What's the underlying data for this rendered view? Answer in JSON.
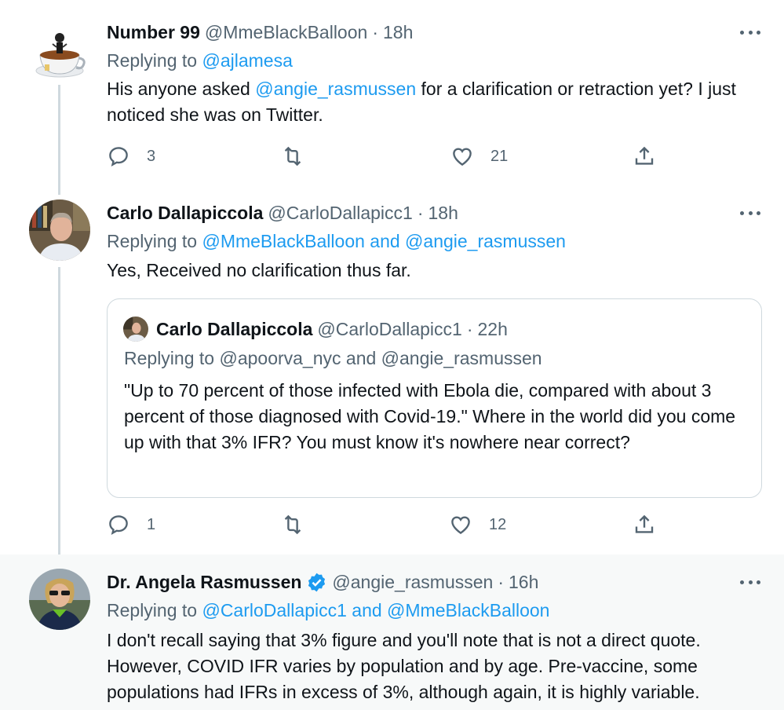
{
  "tweets": [
    {
      "name": "Number 99",
      "handle": "@MmeBlackBalloon",
      "dot": "·",
      "time": "18h",
      "reply_prefix": "Replying to",
      "reply_to": "@ajlamesa",
      "text_before": "His anyone asked ",
      "mention": "@angie_rasmussen",
      "text_after": " for a clarification or retraction yet? I just noticed she was on Twitter.",
      "replies": "3",
      "retweets": "",
      "likes": "21",
      "avatar_icon": "teacup-avatar"
    },
    {
      "name": "Carlo Dallapiccola",
      "handle": "@CarloDallapicc1",
      "dot": "·",
      "time": "18h",
      "reply_prefix": "Replying to",
      "reply_to": "@MmeBlackBalloon and @angie_rasmussen",
      "text": "Yes,  Received no clarification thus far.",
      "replies": "1",
      "retweets": "",
      "likes": "12",
      "avatar_icon": "person-avatar",
      "quote": {
        "name": "Carlo Dallapiccola",
        "handle": "@CarloDallapicc1",
        "dot": "·",
        "time": "22h",
        "reply_prefix": "Replying to",
        "reply_to": "@apoorva_nyc and @angie_rasmussen",
        "text": "\"Up to 70 percent of those infected with Ebola die, compared with about 3 percent of those diagnosed with Covid-19.\"  Where in the world did you come up with that 3% IFR? You must know it's nowhere near correct?"
      }
    },
    {
      "name": "Dr. Angela Rasmussen",
      "handle": "@angie_rasmussen",
      "dot": "·",
      "time": "16h",
      "reply_prefix": "Replying to",
      "reply_to": "@CarloDallapicc1 and @MmeBlackBalloon",
      "text": "I don't recall saying that 3% figure and you'll note that is not a direct quote. However, COVID IFR varies by population and by age. Pre-vaccine, some populations had IFRs in excess of 3%, although again, it is highly variable.",
      "avatar_icon": "person-sunglasses-avatar",
      "verified": true
    }
  ],
  "colors": {
    "link": "#1d9bf0",
    "secondary_text": "#536471",
    "highlight_bg": "#f7f9f9",
    "verified": "#1d9bf0"
  }
}
